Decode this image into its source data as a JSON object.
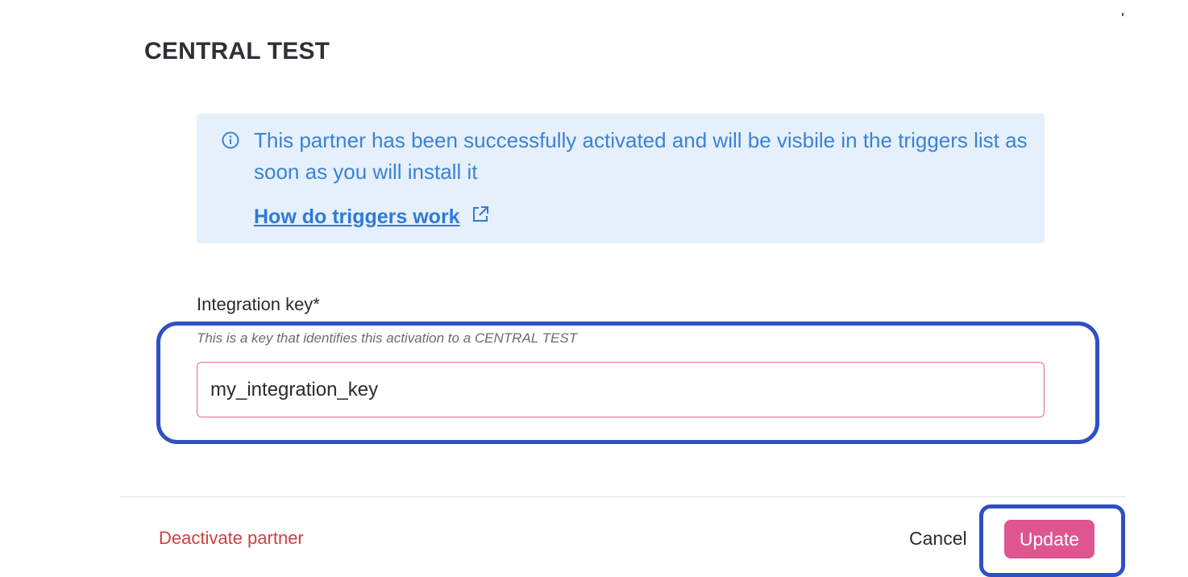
{
  "modal": {
    "title": "CENTRAL TEST"
  },
  "info_banner": {
    "message": "This partner has been successfully activated and will be visbile in the triggers list as soon as you will install it",
    "link_label": "How do triggers work",
    "icon": "info-circle-icon",
    "link_icon": "external-link-icon"
  },
  "integration_key": {
    "label": "Integration key*",
    "help_text": "This is a key that identifies this activation to a CENTRAL TEST",
    "value": "my_integration_key"
  },
  "footer": {
    "deactivate_label": "Deactivate partner",
    "cancel_label": "Cancel",
    "update_label": "Update"
  },
  "colors": {
    "accent": "#df5590",
    "info_background": "#e6f0fb",
    "info_text": "#3b82d6",
    "danger": "#cf3f42",
    "highlight": "#2f4fc6"
  }
}
